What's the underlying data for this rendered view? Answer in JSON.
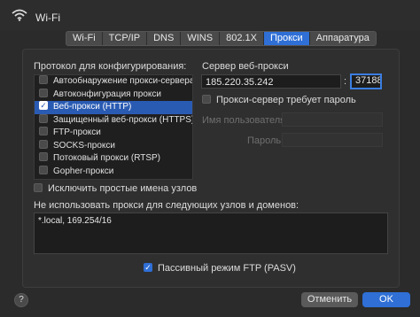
{
  "window": {
    "title": "Wi-Fi"
  },
  "tabs": [
    {
      "label": "Wi-Fi",
      "active": false
    },
    {
      "label": "TCP/IP",
      "active": false
    },
    {
      "label": "DNS",
      "active": false
    },
    {
      "label": "WINS",
      "active": false
    },
    {
      "label": "802.1X",
      "active": false
    },
    {
      "label": "Прокси",
      "active": true
    },
    {
      "label": "Аппаратура",
      "active": false
    }
  ],
  "protocols": {
    "heading": "Протокол для конфигурирования:",
    "items": [
      {
        "label": "Автообнаружение прокси-сервера",
        "checked": false,
        "selected": false
      },
      {
        "label": "Автоконфигурация прокси",
        "checked": false,
        "selected": false
      },
      {
        "label": "Веб-прокси (HTTP)",
        "checked": true,
        "selected": true
      },
      {
        "label": "Защищенный веб-прокси (HTTPS)",
        "checked": false,
        "selected": false
      },
      {
        "label": "FTP-прокси",
        "checked": false,
        "selected": false
      },
      {
        "label": "SOCKS-прокси",
        "checked": false,
        "selected": false
      },
      {
        "label": "Потоковый прокси (RTSP)",
        "checked": false,
        "selected": false
      },
      {
        "label": "Gopher-прокси",
        "checked": false,
        "selected": false
      }
    ]
  },
  "server": {
    "heading": "Сервер веб-прокси",
    "host": "185.220.35.242",
    "separator": ":",
    "port": "37188",
    "requires_password_label": "Прокси-сервер требует пароль",
    "requires_password": false,
    "username_label": "Имя пользователя:",
    "password_label": "Пароль:"
  },
  "exclude_simple_label": "Исключить простые имена узлов",
  "exclude_simple": false,
  "bypass": {
    "heading": "Не использовать прокси для следующих узлов и доменов:",
    "value": "*.local, 169.254/16"
  },
  "passive_ftp_label": "Пассивный режим FTP (PASV)",
  "passive_ftp": true,
  "buttons": {
    "help": "?",
    "cancel": "Отменить",
    "ok": "OK"
  },
  "colors": {
    "accent": "#2f6fd6",
    "background": "#2b2b2b"
  }
}
